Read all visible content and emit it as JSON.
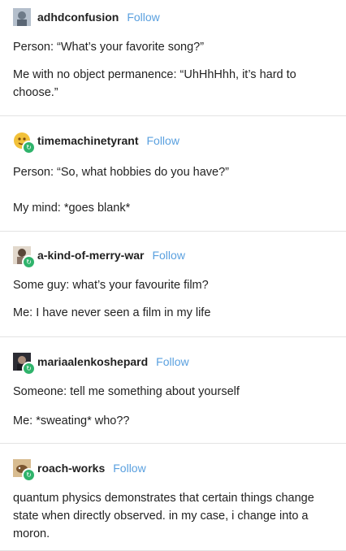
{
  "posts": [
    {
      "username": "adhdconfusion",
      "follow": "Follow",
      "avatar_color": "#9aa7b8",
      "lines": [
        "Person: “What’s your favorite song?”",
        "Me with no object permanence: “UhHhHhh, it’s hard to choose.”"
      ]
    },
    {
      "username": "timemachinetyrant",
      "follow": "Follow",
      "avatar_color": "#f2c13a",
      "lines": [
        "Person: “So, what hobbies do you have?”",
        "My mind: *goes blank*"
      ]
    },
    {
      "username": "a-kind-of-merry-war",
      "follow": "Follow",
      "avatar_color": "#c9b9a8",
      "lines": [
        "Some guy: what’s your favourite film?",
        "Me: I have never seen a film in my life"
      ]
    },
    {
      "username": "mariaalenkoshepard",
      "follow": "Follow",
      "avatar_color": "#3a3a44",
      "lines": [
        "Someone: tell me something about yourself",
        "Me: *sweating* who??"
      ]
    },
    {
      "username": "roach-works",
      "follow": "Follow",
      "avatar_color": "#c8a878",
      "lines": [
        "quantum physics demonstrates that certain things change state when directly observed. in my case, i change into a moron."
      ]
    }
  ],
  "reblog_icon": "reblog-icon"
}
